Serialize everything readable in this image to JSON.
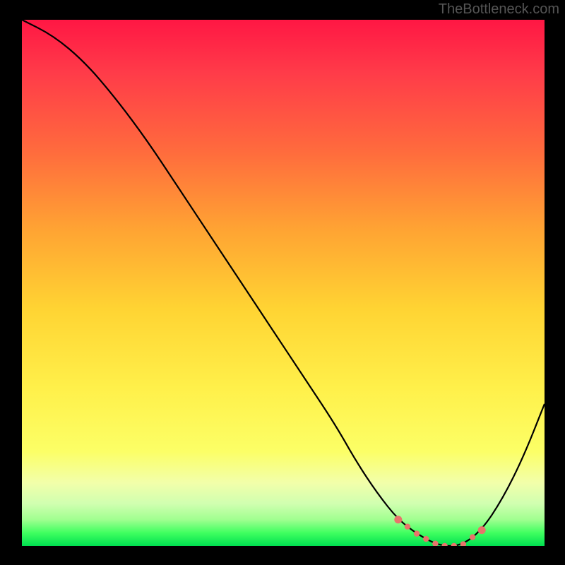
{
  "watermark": "TheBottleneck.com",
  "chart_data": {
    "type": "line",
    "title": "",
    "xlabel": "",
    "ylabel": "",
    "xlim": [
      0,
      100
    ],
    "ylim": [
      0,
      100
    ],
    "series": [
      {
        "name": "bottleneck-curve",
        "x": [
          0,
          6,
          12,
          18,
          24,
          30,
          36,
          42,
          48,
          54,
          60,
          64,
          68,
          72,
          76,
          80,
          84,
          88,
          92,
          96,
          100
        ],
        "values": [
          100,
          97,
          92,
          85,
          77,
          68,
          59,
          50,
          41,
          32,
          23,
          16,
          10,
          5,
          2,
          0,
          0,
          3,
          9,
          17,
          27
        ]
      }
    ],
    "sweet_spot_range_x": [
      72,
      88
    ],
    "gradient_colors": {
      "top": "#ff1744",
      "mid": "#ffd433",
      "bottom": "#00e050"
    },
    "marker_color": "#e8746b"
  }
}
